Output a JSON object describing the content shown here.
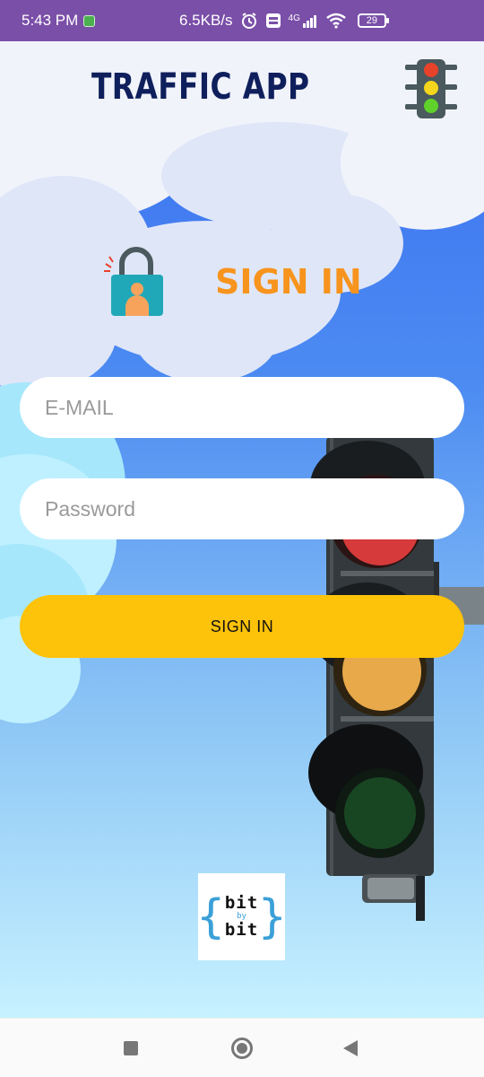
{
  "status_bar": {
    "time": "5:43 PM",
    "net_speed": "6.5KB/s",
    "network_type": "4G",
    "battery_level": "29",
    "icons": [
      "app-notification-icon",
      "alarm-icon",
      "volte-icon",
      "signal-icon",
      "wifi-icon",
      "battery-icon"
    ]
  },
  "header": {
    "title": "TRAFFIC APP",
    "logo_icon": "traffic-light-icon"
  },
  "signin": {
    "heading": "SIGN IN",
    "lock_icon": "lock-user-icon",
    "email_placeholder": "E-MAIL",
    "password_placeholder": "Password",
    "button_label": "SIGN IN"
  },
  "footer_logo": {
    "word_top": "bit",
    "word_mid": "by",
    "word_bottom": "bit",
    "brace_left": "{",
    "brace_right": "}"
  },
  "nav_bar": {
    "icons": [
      "recent-apps-icon",
      "home-icon",
      "back-icon"
    ]
  },
  "colors": {
    "status_bar": "#7a4fa8",
    "title": "#0f1f5c",
    "signin_heading": "#f7941d",
    "button": "#fdc20a",
    "logo_accent": "#3ba0d8"
  }
}
